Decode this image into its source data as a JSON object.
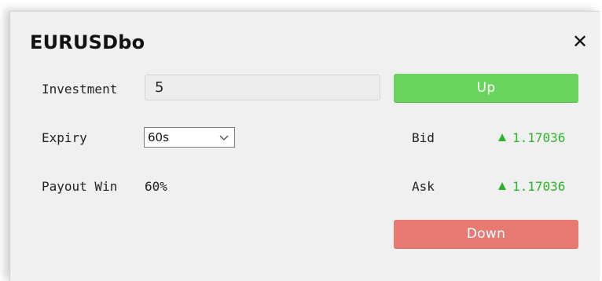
{
  "dialog": {
    "title": "EURUSDbo",
    "close_label": "✕"
  },
  "investment": {
    "label": "Investment",
    "value": "5"
  },
  "expiry": {
    "label": "Expiry",
    "selected": "60s"
  },
  "payout": {
    "label": "Payout Win",
    "value": "60%"
  },
  "bid": {
    "label": "Bid",
    "value": "1.17036",
    "direction_icon": "up-triangle-icon"
  },
  "ask": {
    "label": "Ask",
    "value": "1.17036",
    "direction_icon": "up-triangle-icon"
  },
  "buttons": {
    "up_label": "Up",
    "down_label": "Down"
  },
  "colors": {
    "up_button": "#6ad45f",
    "down_button": "#e77b74",
    "price_up": "#2bb52b"
  }
}
